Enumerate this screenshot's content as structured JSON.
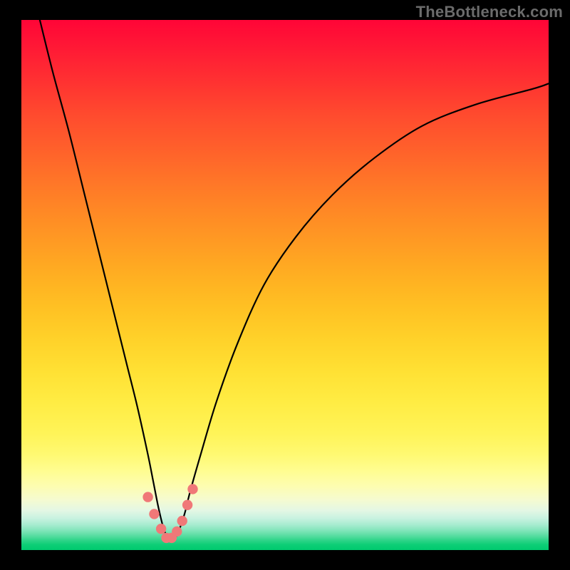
{
  "watermark": "TheBottleneck.com",
  "colors": {
    "background": "#000000",
    "marker": "#f07878",
    "curve": "#000000",
    "gradient_top": "#ff0537",
    "gradient_bottom": "#00ca6f"
  },
  "chart_data": {
    "type": "line",
    "title": "",
    "xlabel": "",
    "ylabel": "",
    "xlim": [
      0,
      100
    ],
    "ylim": [
      0,
      100
    ],
    "note": "Bottleneck percentage curve with minimum (optimal point) near x≈28. Values read from curve relative to a 0–100 scale on both axes (y=0 at bottom/green, y=100 at top/red). Marker points highlight the near-zero region around the minimum.",
    "series": [
      {
        "name": "bottleneck-curve",
        "x": [
          3.5,
          6,
          9,
          12,
          15,
          18,
          20,
          22,
          24,
          25,
          26,
          27,
          28,
          29,
          30,
          31,
          32,
          34,
          37,
          41,
          46,
          52,
          59,
          67,
          76,
          86,
          97,
          100
        ],
        "values": [
          100,
          90,
          79,
          67,
          55,
          43,
          35,
          27,
          18,
          13,
          8,
          4,
          2,
          2,
          4,
          7,
          11,
          18,
          28,
          39,
          50,
          59,
          67,
          74,
          80,
          84,
          87,
          88
        ]
      }
    ],
    "markers": [
      {
        "x": 24.0,
        "y": 10.0
      },
      {
        "x": 25.2,
        "y": 6.8
      },
      {
        "x": 26.5,
        "y": 4.0
      },
      {
        "x": 27.5,
        "y": 2.3
      },
      {
        "x": 28.5,
        "y": 2.3
      },
      {
        "x": 29.5,
        "y": 3.5
      },
      {
        "x": 30.5,
        "y": 5.5
      },
      {
        "x": 31.5,
        "y": 8.5
      },
      {
        "x": 32.5,
        "y": 11.5
      }
    ]
  }
}
